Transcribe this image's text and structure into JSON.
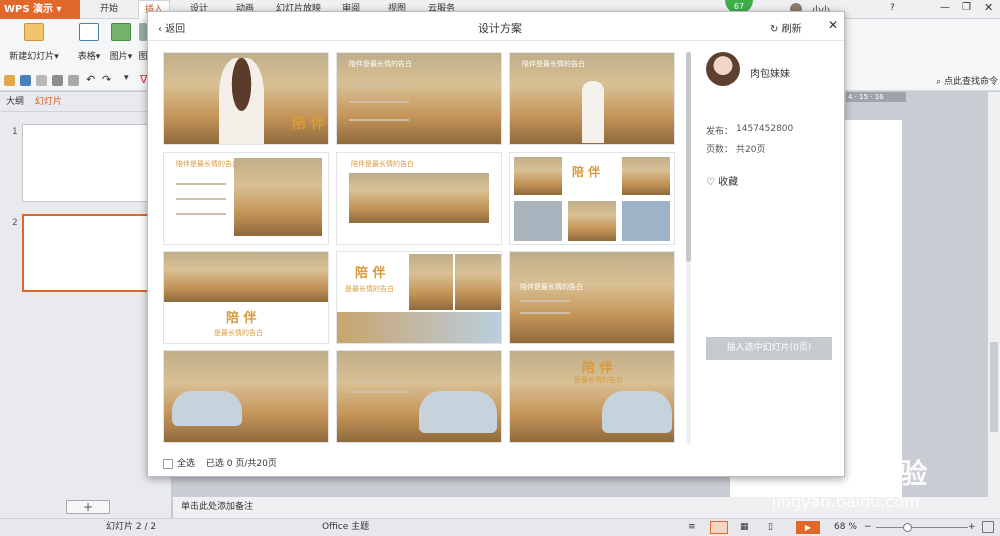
{
  "app": {
    "name": "WPS 演示",
    "badge": "67"
  },
  "menu": {
    "tabs": [
      "开始",
      "插入",
      "设计",
      "动画",
      "幻灯片放映",
      "审阅",
      "视图",
      "云服务"
    ],
    "active": "插入",
    "user": "小小"
  },
  "ribbon": {
    "new_slide": "新建幻灯片",
    "table": "表格",
    "image": "图片",
    "third": "图"
  },
  "quick": {
    "search": "点此查找命令"
  },
  "ruler": {
    "marks": "4 · 15 · 16"
  },
  "left": {
    "tab_outline": "大纲",
    "tab_slides": "幻灯片",
    "slide1": "1",
    "slide2": "2",
    "add": "+"
  },
  "modal": {
    "back": "返回",
    "title": "设计方案",
    "refresh": "刷新",
    "author": "肉包妹妹",
    "publish_label": "发布：",
    "publish_value": "1457452800",
    "pages_label": "页数：",
    "pages_value": "共20页",
    "favorite": "收藏",
    "insert_button": "插入选中幻灯片(0页)",
    "select_all": "全选",
    "selected": "已选 0 页/共20页",
    "card_heading": "陪伴是最长情的告白",
    "card_big": "陪 伴",
    "card_sub": "是最长情的告白"
  },
  "notes": {
    "placeholder": "单击此处添加备注"
  },
  "status": {
    "slide": "幻灯片 2 / 2",
    "theme": "Office 主题",
    "zoom": "68 %"
  },
  "watermark": {
    "brand": "Bai du 经验",
    "url": "jingyan.baidu.com"
  },
  "colors": {
    "wps_orange": "#e2672b",
    "active_tab": "#d45d25",
    "gold": "#d89a3b"
  }
}
